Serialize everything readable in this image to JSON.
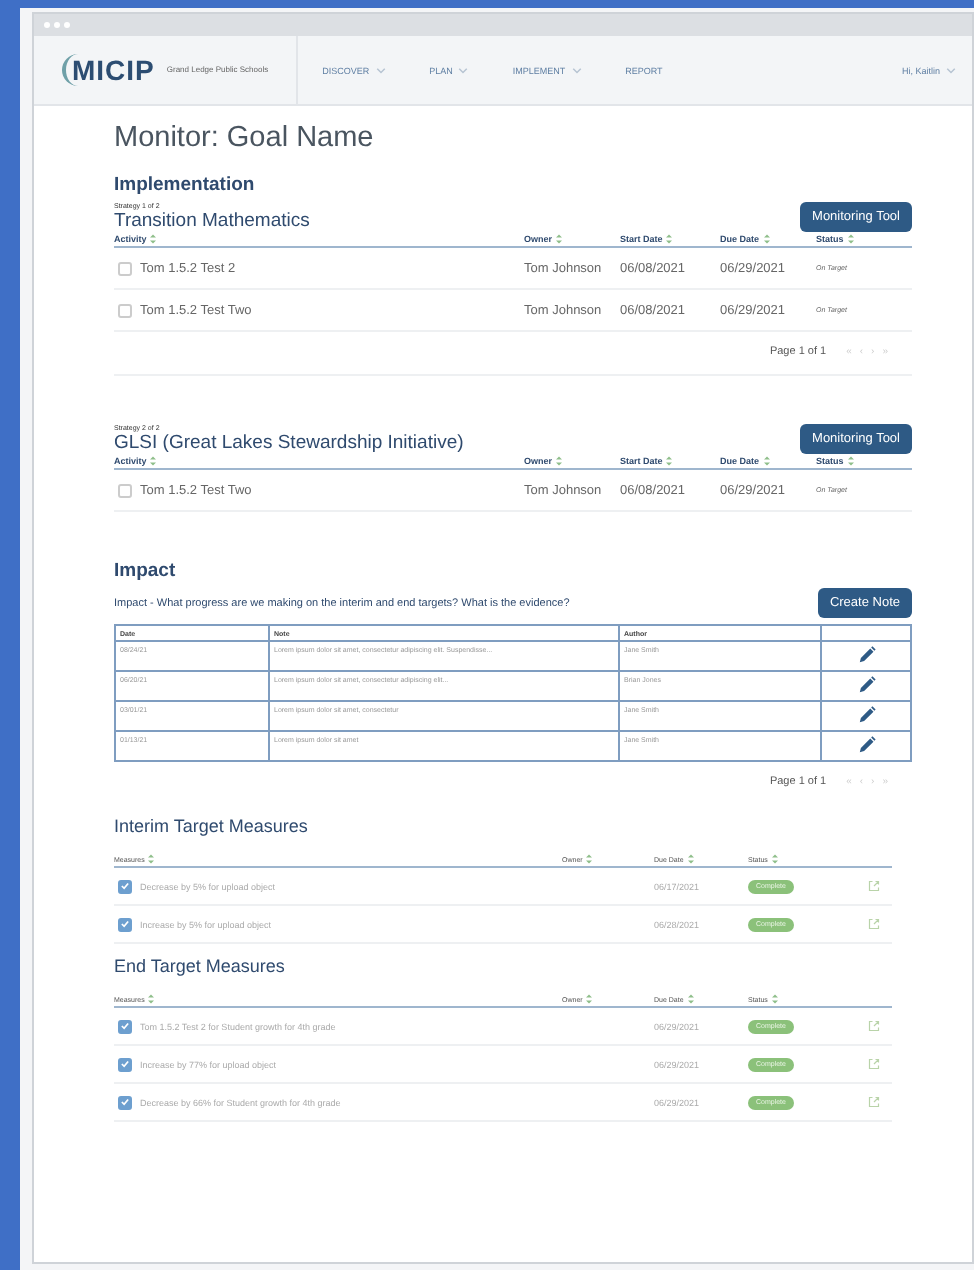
{
  "nav": {
    "logo": "MICIP",
    "district": "Grand Ledge Public Schools",
    "menu": [
      {
        "label": "DISCOVER",
        "dropdown": true
      },
      {
        "label": "PLAN",
        "dropdown": true
      },
      {
        "label": "IMPLEMENT",
        "dropdown": true
      },
      {
        "label": "REPORT",
        "dropdown": false
      }
    ],
    "user": "Hi, Kaitlin"
  },
  "page_title": "Monitor: Goal Name",
  "implementation": {
    "heading": "Implementation",
    "strategies": [
      {
        "counter": "Strategy 1 of 2",
        "name": "Transition Mathematics",
        "button": "Monitoring Tool",
        "columns": [
          "Activity",
          "Owner",
          "Start Date",
          "Due Date",
          "Status"
        ],
        "rows": [
          {
            "activity": "Tom 1.5.2 Test 2",
            "checked": false,
            "owner": "Tom Johnson",
            "start": "06/08/2021",
            "due": "06/29/2021",
            "status": "On Target"
          },
          {
            "activity": "Tom 1.5.2 Test Two",
            "checked": false,
            "owner": "Tom Johnson",
            "start": "06/08/2021",
            "due": "06/29/2021",
            "status": "On Target"
          }
        ],
        "pagination": {
          "label": "Page 1 of 1",
          "arrows": [
            "«",
            "‹",
            "›",
            "»"
          ]
        }
      },
      {
        "counter": "Strategy 2 of 2",
        "name": "GLSI (Great Lakes Stewardship Initiative)",
        "button": "Monitoring Tool",
        "columns": [
          "Activity",
          "Owner",
          "Start Date",
          "Due Date",
          "Status"
        ],
        "rows": [
          {
            "activity": "Tom 1.5.2 Test Two",
            "checked": false,
            "owner": "Tom Johnson",
            "start": "06/08/2021",
            "due": "06/29/2021",
            "status": "On Target"
          }
        ]
      }
    ]
  },
  "impact": {
    "heading": "Impact",
    "question": "Impact - What progress are we making on the interim and end targets? What is the evidence?",
    "button": "Create Note",
    "columns": [
      "Date",
      "Note",
      "Author"
    ],
    "rows": [
      {
        "date": "08/24/21",
        "note": "Lorem ipsum dolor sit amet, consectetur adipiscing elit. Suspendisse...",
        "author": "Jane Smith"
      },
      {
        "date": "06/20/21",
        "note": "Lorem ipsum dolor sit amet, consectetur adipiscing elit...",
        "author": "Brian Jones"
      },
      {
        "date": "03/01/21",
        "note": "Lorem ipsum dolor sit amet, consectetur",
        "author": "Jane Smith"
      },
      {
        "date": "01/13/21",
        "note": "Lorem ipsum dolor sit amet",
        "author": "Jane Smith"
      }
    ],
    "pagination": {
      "label": "Page 1 of 1",
      "arrows": [
        "«",
        "‹",
        "›",
        "»"
      ]
    }
  },
  "measure_sections": [
    {
      "heading": "Interim Target Measures",
      "columns": [
        "Measures",
        "Owner",
        "Due Date",
        "Status"
      ],
      "rows": [
        {
          "measure": "Decrease by 5% for upload object",
          "checked": true,
          "due": "06/17/2021",
          "status": "Complete"
        },
        {
          "measure": "Increase by 5% for upload object",
          "checked": true,
          "due": "06/28/2021",
          "status": "Complete"
        }
      ]
    },
    {
      "heading": "End Target Measures",
      "columns": [
        "Measures",
        "Owner",
        "Due Date",
        "Status"
      ],
      "rows": [
        {
          "measure": "Tom 1.5.2 Test 2 for Student growth for 4th grade",
          "checked": true,
          "due": "06/29/2021",
          "status": "Complete"
        },
        {
          "measure": "Increase by 77% for upload object",
          "checked": true,
          "due": "06/29/2021",
          "status": "Complete"
        },
        {
          "measure": "Decrease by 66% for Student growth for 4th grade",
          "checked": true,
          "due": "06/29/2021",
          "status": "Complete"
        }
      ]
    }
  ]
}
